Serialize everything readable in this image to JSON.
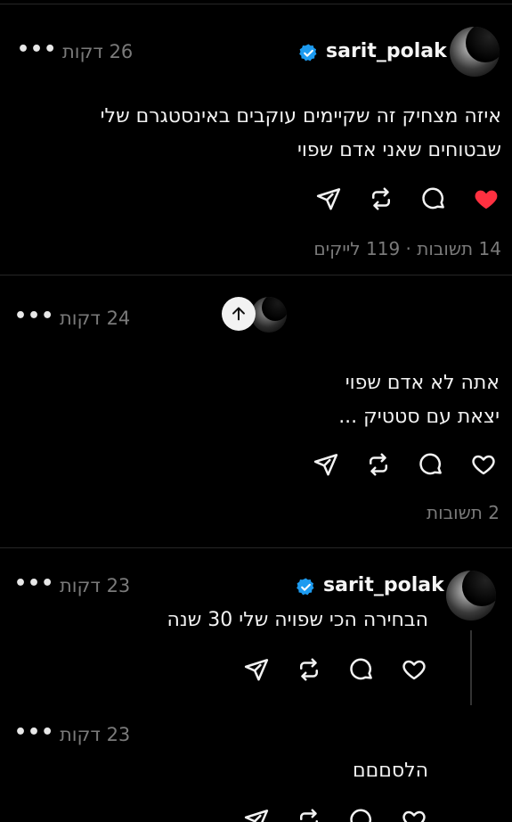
{
  "posts": [
    {
      "username": "sarit_polak",
      "time": "26 דקות",
      "lines": [
        "איזה מצחיק זה שקיימים עוקבים באינסטגרם שלי",
        "שבטוחים שאני אדם שפוי"
      ],
      "stats": "14 תשובות · 119 לייקים",
      "liked": true
    },
    {
      "time": "24 דקות",
      "lines": [
        "אתה לא אדם שפוי",
        "יצאת עם סטטיק ..."
      ],
      "stats": "2 תשובות"
    },
    {
      "username": "sarit_polak",
      "time": "23 דקות",
      "lines": [
        "הבחירה הכי שפויה שלי 30 שנה"
      ]
    },
    {
      "time": "23 דקות",
      "lines": [
        "הלסםםם"
      ]
    }
  ],
  "icons": {
    "more": "more-options-icon",
    "verified": "verified-badge-icon",
    "share": "share-icon",
    "repost": "repost-icon",
    "reply": "comment-icon",
    "like": "heart-icon",
    "scroll": "arrow-up-icon"
  },
  "colors": {
    "background": "#000000",
    "verified": "#1d9bf0",
    "like": "#ff3040",
    "muted": "#7a7a7a"
  }
}
